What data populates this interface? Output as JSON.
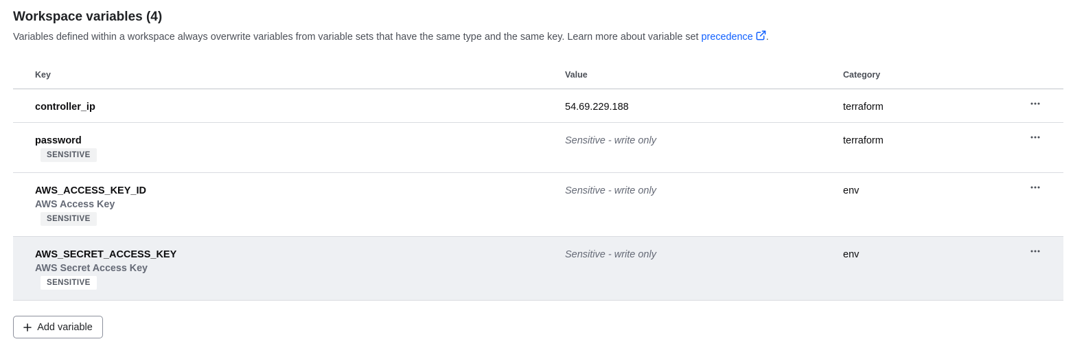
{
  "section": {
    "title": "Workspace variables (4)",
    "description_prefix": "Variables defined within a workspace always overwrite variables from variable sets that have the same type and the same key. Learn more about variable set ",
    "link_text": "precedence",
    "description_suffix": "."
  },
  "table": {
    "headers": {
      "key": "Key",
      "value": "Value",
      "category": "Category"
    },
    "rows": [
      {
        "key": "controller_ip",
        "description": "",
        "sensitive": false,
        "value": "54.69.229.188",
        "category": "terraform"
      },
      {
        "key": "password",
        "description": "",
        "sensitive": true,
        "badge": "SENSITIVE",
        "value": "Sensitive - write only",
        "category": "terraform"
      },
      {
        "key": "AWS_ACCESS_KEY_ID",
        "description": "AWS Access Key",
        "sensitive": true,
        "badge": "SENSITIVE",
        "value": "Sensitive - write only",
        "category": "env"
      },
      {
        "key": "AWS_SECRET_ACCESS_KEY",
        "description": "AWS Secret Access Key",
        "sensitive": true,
        "badge": "SENSITIVE",
        "value": "Sensitive - write only",
        "category": "env",
        "hovered": true
      }
    ],
    "row_menu_icon": "ellipsis-horizontal-icon"
  },
  "actions": {
    "add_variable_label": "Add variable",
    "add_icon": "plus-icon"
  },
  "colors": {
    "link": "#1060ff",
    "hover_row": "#eef0f3",
    "badge_bg": "#f1f2f3"
  }
}
